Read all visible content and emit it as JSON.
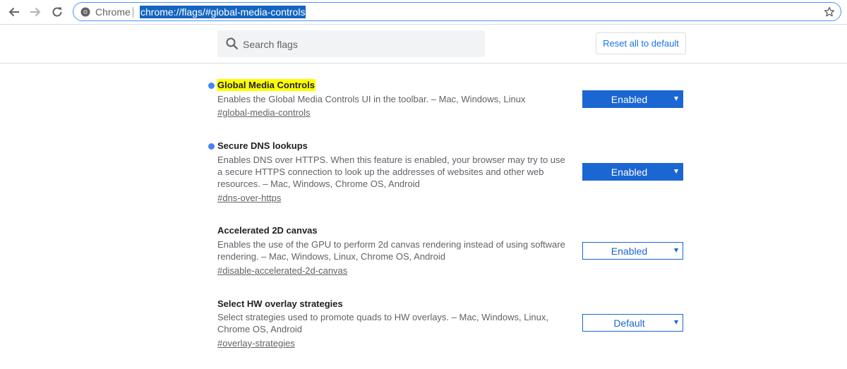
{
  "browser": {
    "site_name": "Chrome",
    "url": "chrome://flags/#global-media-controls"
  },
  "header": {
    "search_placeholder": "Search flags",
    "reset_label": "Reset all to default"
  },
  "experiments": [
    {
      "title": "Global Media Controls",
      "description": "Enables the Global Media Controls UI in the toolbar. – Mac, Windows, Linux",
      "link": "#global-media-controls",
      "value": "Enabled"
    },
    {
      "title": "Secure DNS lookups",
      "description": "Enables DNS over HTTPS. When this feature is enabled, your browser may try to use a secure HTTPS connection to look up the addresses of websites and other web resources. – Mac, Windows, Chrome OS, Android",
      "link": "#dns-over-https",
      "value": "Enabled"
    },
    {
      "title": "Accelerated 2D canvas",
      "description": "Enables the use of the GPU to perform 2d canvas rendering instead of using software rendering. – Mac, Windows, Linux, Chrome OS, Android",
      "link": "#disable-accelerated-2d-canvas",
      "value": "Enabled"
    },
    {
      "title": "Select HW overlay strategies",
      "description": "Select strategies used to promote quads to HW overlays. – Mac, Windows, Linux, Chrome OS, Android",
      "link": "#overlay-strategies",
      "value": "Default"
    }
  ],
  "colors": {
    "accent": "#1a66d2",
    "highlight": "#ffff00",
    "modified_dot": "#4285f4"
  }
}
